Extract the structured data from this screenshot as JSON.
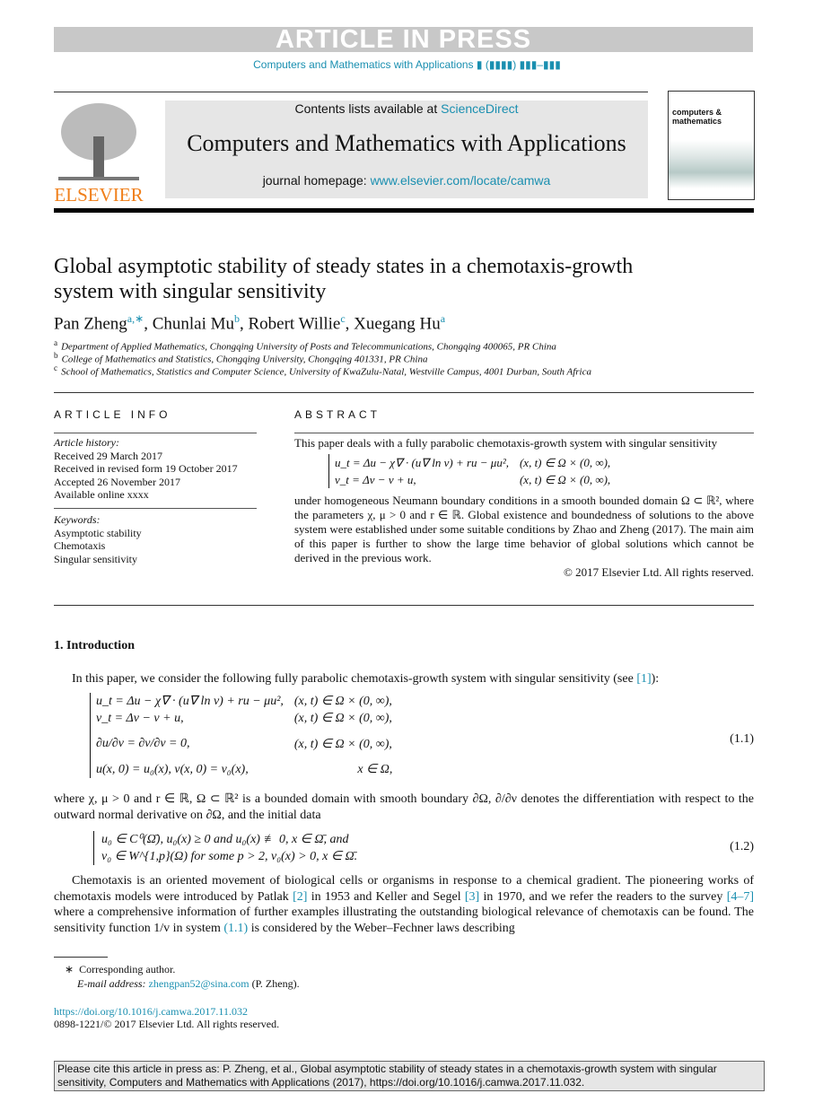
{
  "banner": "ARTICLE IN PRESS",
  "journal_line": "Computers and Mathematics with Applications ▮ (▮▮▮▮) ▮▮▮–▮▮▮",
  "header": {
    "contents_prefix": "Contents lists available at ",
    "sciencedirect": "ScienceDirect",
    "journal_name": "Computers and Mathematics with Applications",
    "homepage_prefix": "journal homepage: ",
    "homepage_url": "www.elsevier.com/locate/camwa",
    "publisher": "ELSEVIER",
    "cover_title": "computers & mathematics"
  },
  "title": "Global asymptotic stability of steady states in a chemotaxis-growth system with singular sensitivity",
  "authors": [
    {
      "name": "Pan Zheng",
      "sup": "a,∗"
    },
    {
      "name": "Chunlai Mu",
      "sup": "b"
    },
    {
      "name": "Robert Willie",
      "sup": "c"
    },
    {
      "name": "Xuegang Hu",
      "sup": "a"
    }
  ],
  "affiliations": [
    {
      "sup": "a",
      "text": "Department of Applied Mathematics, Chongqing University of Posts and Telecommunications, Chongqing 400065, PR China"
    },
    {
      "sup": "b",
      "text": "College of Mathematics and Statistics, Chongqing University, Chongqing 401331, PR China"
    },
    {
      "sup": "c",
      "text": "School of Mathematics, Statistics and Computer Science, University of KwaZulu-Natal, Westville Campus, 4001 Durban, South Africa"
    }
  ],
  "info": {
    "heading": "ARTICLE INFO",
    "history_label": "Article history:",
    "history": [
      "Received 29 March 2017",
      "Received in revised form 19 October 2017",
      "Accepted 26 November 2017",
      "Available online xxxx"
    ],
    "keywords_label": "Keywords:",
    "keywords": [
      "Asymptotic stability",
      "Chemotaxis",
      "Singular sensitivity"
    ]
  },
  "abstract": {
    "heading": "ABSTRACT",
    "p1": "This paper deals with a fully parabolic chemotaxis-growth system with singular sensitivity",
    "eq": [
      [
        "u_t = Δu − χ∇ · (u∇ ln v) + ru − μu²,",
        "(x, t) ∈ Ω × (0, ∞),"
      ],
      [
        "v_t = Δv − v + u,",
        "(x, t) ∈ Ω × (0, ∞),"
      ]
    ],
    "p2": "under homogeneous Neumann boundary conditions in a smooth bounded domain Ω ⊂ ℝ², where the parameters χ, μ > 0 and r ∈ ℝ. Global existence and boundedness of solutions to the above system were established under some suitable conditions by Zhao and Zheng (2017). The main aim of this paper is further to show the large time behavior of global solutions which cannot be derived in the previous work.",
    "copyright": "© 2017 Elsevier Ltd. All rights reserved."
  },
  "intro": {
    "heading": "1.  Introduction",
    "p1_a": "In this paper, we consider the following fully parabolic chemotaxis-growth system with singular sensitivity (see ",
    "p1_ref": "[1]",
    "p1_b": "):",
    "eq11": [
      [
        "u_t = Δu − χ∇ · (u∇ ln v) + ru − μu²,",
        "(x, t) ∈ Ω × (0, ∞),"
      ],
      [
        "v_t = Δv − v + u,",
        "(x, t) ∈ Ω × (0, ∞),"
      ],
      [
        "∂u/∂ν = ∂v/∂ν = 0,",
        "(x, t) ∈ Ω × (0, ∞),"
      ],
      [
        "u(x, 0) = u₀(x), v(x, 0) = v₀(x),",
        "x ∈ Ω,"
      ]
    ],
    "eq11_num": "(1.1)",
    "p2": "where χ, μ > 0 and r ∈ ℝ, Ω ⊂ ℝ² is a bounded domain with smooth boundary ∂Ω, ∂/∂ν denotes the differentiation with respect to the outward normal derivative on ∂Ω, and the initial data",
    "eq12": [
      "u₀ ∈ C⁰(Ω̄), u₀(x) ≥ 0 and u₀(x) ≢ 0, x ∈ Ω̄,    and",
      "v₀ ∈ W^{1,p}(Ω)   for some p > 2, v₀(x) > 0, x ∈ Ω̄."
    ],
    "eq12_num": "(1.2)",
    "p3_a": "Chemotaxis is an oriented movement of biological cells or organisms in response to a chemical gradient. The pioneering works of chemotaxis models were introduced by Patlak ",
    "r2": "[2]",
    "p3_b": " in 1953 and Keller and Segel ",
    "r3": "[3]",
    "p3_c": " in 1970, and we refer the readers to the survey ",
    "r47": "[4–7]",
    "p3_d": " where a comprehensive information of further examples illustrating the outstanding biological relevance of chemotaxis can be found. The sensitivity function 1/v in system ",
    "r11": "(1.1)",
    "p3_e": " is considered by the Weber–Fechner laws describing"
  },
  "footnote": {
    "star": "∗",
    "corresponding": "Corresponding author.",
    "email_label": "E-mail address: ",
    "email": "zhengpan52@sina.com",
    "email_suffix": " (P. Zheng)."
  },
  "doi": "https://doi.org/10.1016/j.camwa.2017.11.032",
  "issn": "0898-1221/© 2017 Elsevier Ltd. All rights reserved.",
  "citation": "Please cite this article in press as: P. Zheng, et al., Global asymptotic stability of steady states in a chemotaxis-growth system with singular sensitivity, Computers and Mathematics with Applications (2017), https://doi.org/10.1016/j.camwa.2017.11.032.",
  "colors": {
    "link": "#1a8fb0",
    "elsevier": "#f07f1a",
    "banner": "#c8c8c8",
    "box": "#e6e6e6"
  }
}
